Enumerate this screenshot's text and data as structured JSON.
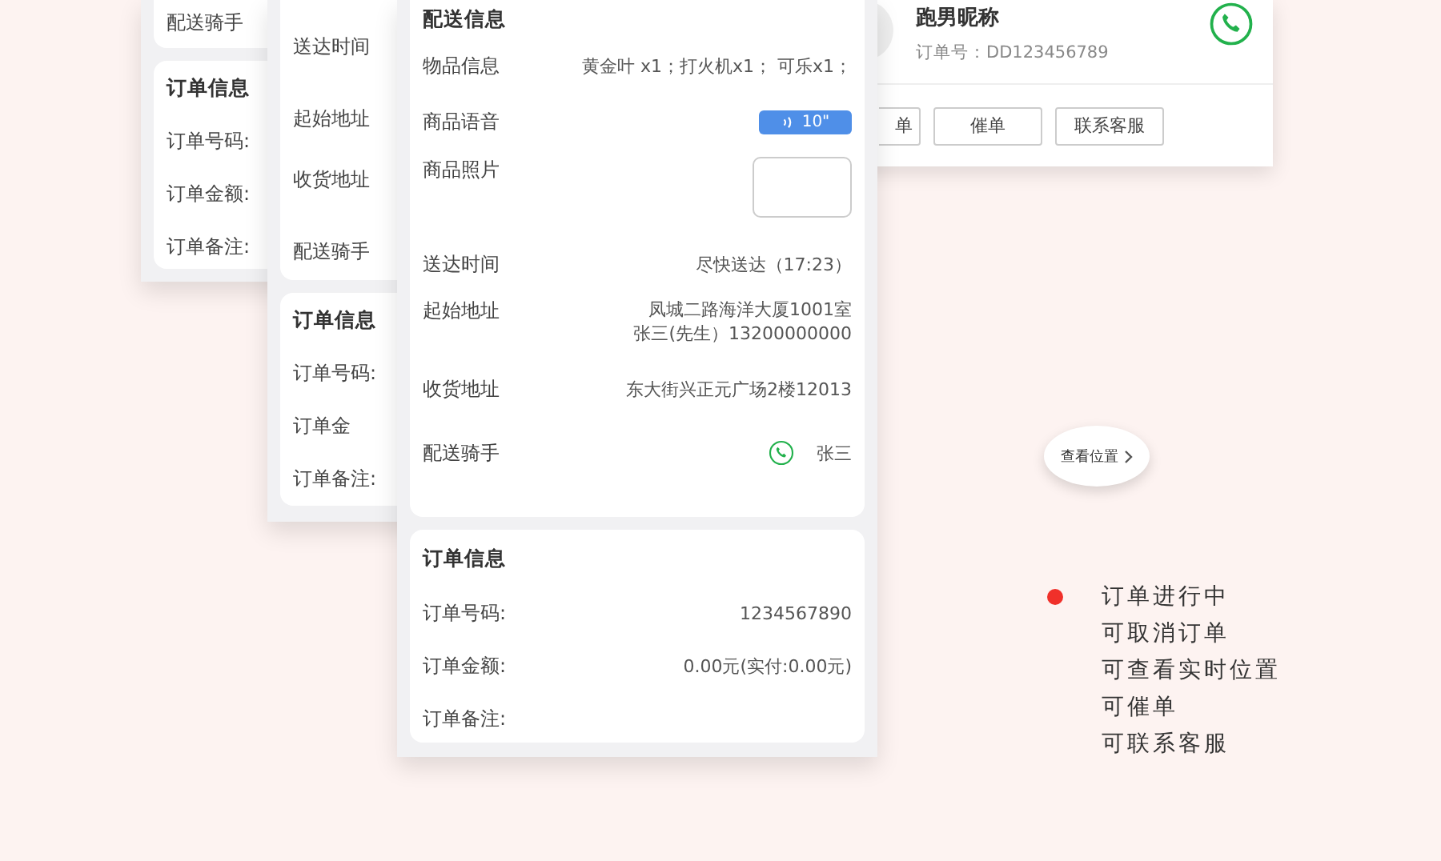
{
  "back_screen": {
    "rows": [
      "配送骑手"
    ],
    "order_title": "订单信息",
    "order_labels": [
      "订单号码:",
      "订单金额:",
      "订单备注:"
    ]
  },
  "middle_screen": {
    "rows": [
      "送达时间",
      "起始地址",
      "收货地址",
      "配送骑手"
    ],
    "order_title": "订单信息",
    "order_labels": [
      "订单号码:",
      "订单金",
      "订单备注:"
    ]
  },
  "front_screen": {
    "title": "配送信息",
    "rows": [
      {
        "kind": "text",
        "label": "物品信息",
        "value": "黄金叶 x1；打火机x1； 可乐x1；"
      },
      {
        "kind": "voice",
        "label": "商品语音",
        "value": "10\""
      },
      {
        "kind": "photo",
        "label": "商品照片"
      },
      {
        "kind": "text",
        "label": "送达时间",
        "value": "尽快送达（17:23）"
      },
      {
        "kind": "address",
        "label": "起始地址",
        "value": "凤城二路海洋大厦1001室",
        "contact": "张三(先生）13200000000"
      },
      {
        "kind": "text",
        "label": "收货地址",
        "value": "东大街兴正元广场2楼12013"
      },
      {
        "kind": "rider",
        "label": "配送骑手",
        "value": "张三"
      }
    ],
    "order_title": "订单信息",
    "order_rows": [
      {
        "label": "订单号码:",
        "value": "1234567890"
      },
      {
        "label": "订单金额:",
        "value": "0.00元(实付:0.00元)"
      },
      {
        "label": "订单备注:"
      }
    ]
  },
  "rider_card": {
    "name": "跑男昵称",
    "order_number": "订单号：DD123456789",
    "buttons": [
      "单",
      "催单",
      "联系客服"
    ]
  },
  "map_bubble": {
    "label": "查看位置"
  },
  "features": {
    "color": "#f0302a",
    "items": [
      "订单进行中",
      "可取消订单",
      "可查看实时位置",
      "可催单",
      "可联系客服"
    ]
  }
}
